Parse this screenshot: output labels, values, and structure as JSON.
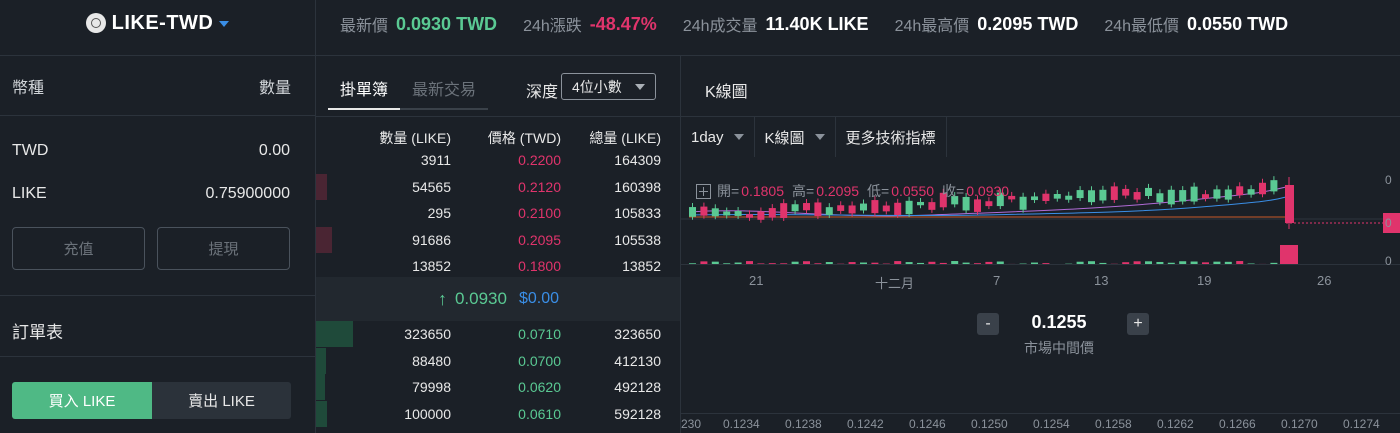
{
  "header": {
    "pair": "LIKE-TWD",
    "stats": [
      {
        "label": "最新價",
        "value": "0.0930 TWD",
        "color": "green"
      },
      {
        "label": "24h漲跌",
        "value": "-48.47%",
        "color": "red"
      },
      {
        "label": "24h成交量",
        "value": "11.40K LIKE",
        "color": "white"
      },
      {
        "label": "24h最高價",
        "value": "0.2095 TWD",
        "color": "white"
      },
      {
        "label": "24h最低價",
        "value": "0.0550 TWD",
        "color": "white"
      }
    ]
  },
  "wallet": {
    "col_currency": "幣種",
    "col_amount": "數量",
    "balances": [
      {
        "currency": "TWD",
        "amount": "0.00"
      },
      {
        "currency": "LIKE",
        "amount": "0.75900000"
      }
    ],
    "deposit_label": "充值",
    "withdraw_label": "提現",
    "orders_title": "訂單表",
    "buy_label": "買入 LIKE",
    "sell_label": "賣出 LIKE"
  },
  "orderbook": {
    "tab_orderbook": "掛單簿",
    "tab_recent": "最新交易",
    "depth_label": "深度",
    "depth_value": "4位小數",
    "col_amount": "數量 (LIKE)",
    "col_price": "價格 (TWD)",
    "col_total": "總量 (LIKE)",
    "asks": [
      {
        "amount": "3911",
        "price": "0.2200",
        "total": "164309",
        "depth": 0.0
      },
      {
        "amount": "54565",
        "price": "0.2120",
        "total": "160398",
        "depth": 0.03
      },
      {
        "amount": "295",
        "price": "0.2100",
        "total": "105833",
        "depth": 0.0
      },
      {
        "amount": "91686",
        "price": "0.2095",
        "total": "105538",
        "depth": 0.045
      },
      {
        "amount": "13852",
        "price": "0.1800",
        "total": "13852",
        "depth": 0.0
      }
    ],
    "mid": {
      "arrow": "↑",
      "price": "0.0930",
      "usd": "$0.00"
    },
    "bids": [
      {
        "amount": "323650",
        "price": "0.0710",
        "total": "323650",
        "depth": 0.1
      },
      {
        "amount": "88480",
        "price": "0.0700",
        "total": "412130",
        "depth": 0.028
      },
      {
        "amount": "79998",
        "price": "0.0620",
        "total": "492128",
        "depth": 0.025
      },
      {
        "amount": "100000",
        "price": "0.0610",
        "total": "592128",
        "depth": 0.03
      }
    ]
  },
  "chart_panel": {
    "title": "K線圖",
    "interval": "1day",
    "chart_type": "K線圖",
    "indicators": "更多技術指標",
    "ohlc": {
      "open_label": "開=",
      "open": "0.1805",
      "high_label": "高=",
      "high": "0.2095",
      "low_label": "低=",
      "low": "0.0550",
      "close_label": "收=",
      "close": "0.0930"
    },
    "x_dates": [
      "21",
      "十二月",
      "7",
      "13",
      "19",
      "26"
    ],
    "mid_price": "0.1255",
    "mid_price_label": "市場中間價",
    "zoom_minus": "-",
    "zoom_plus": "+",
    "depth_prices": [
      "230",
      "0.1234",
      "0.1238",
      "0.1242",
      "0.1246",
      "0.1250",
      "0.1254",
      "0.1258",
      "0.1262",
      "0.1266",
      "0.1270",
      "0.1274"
    ],
    "right_axis": [
      "0",
      "0",
      "0"
    ]
  },
  "colors": {
    "green": "#5ac993",
    "red": "#e0346c",
    "accent": "#3a8ee6",
    "bg": "#1b2027"
  }
}
